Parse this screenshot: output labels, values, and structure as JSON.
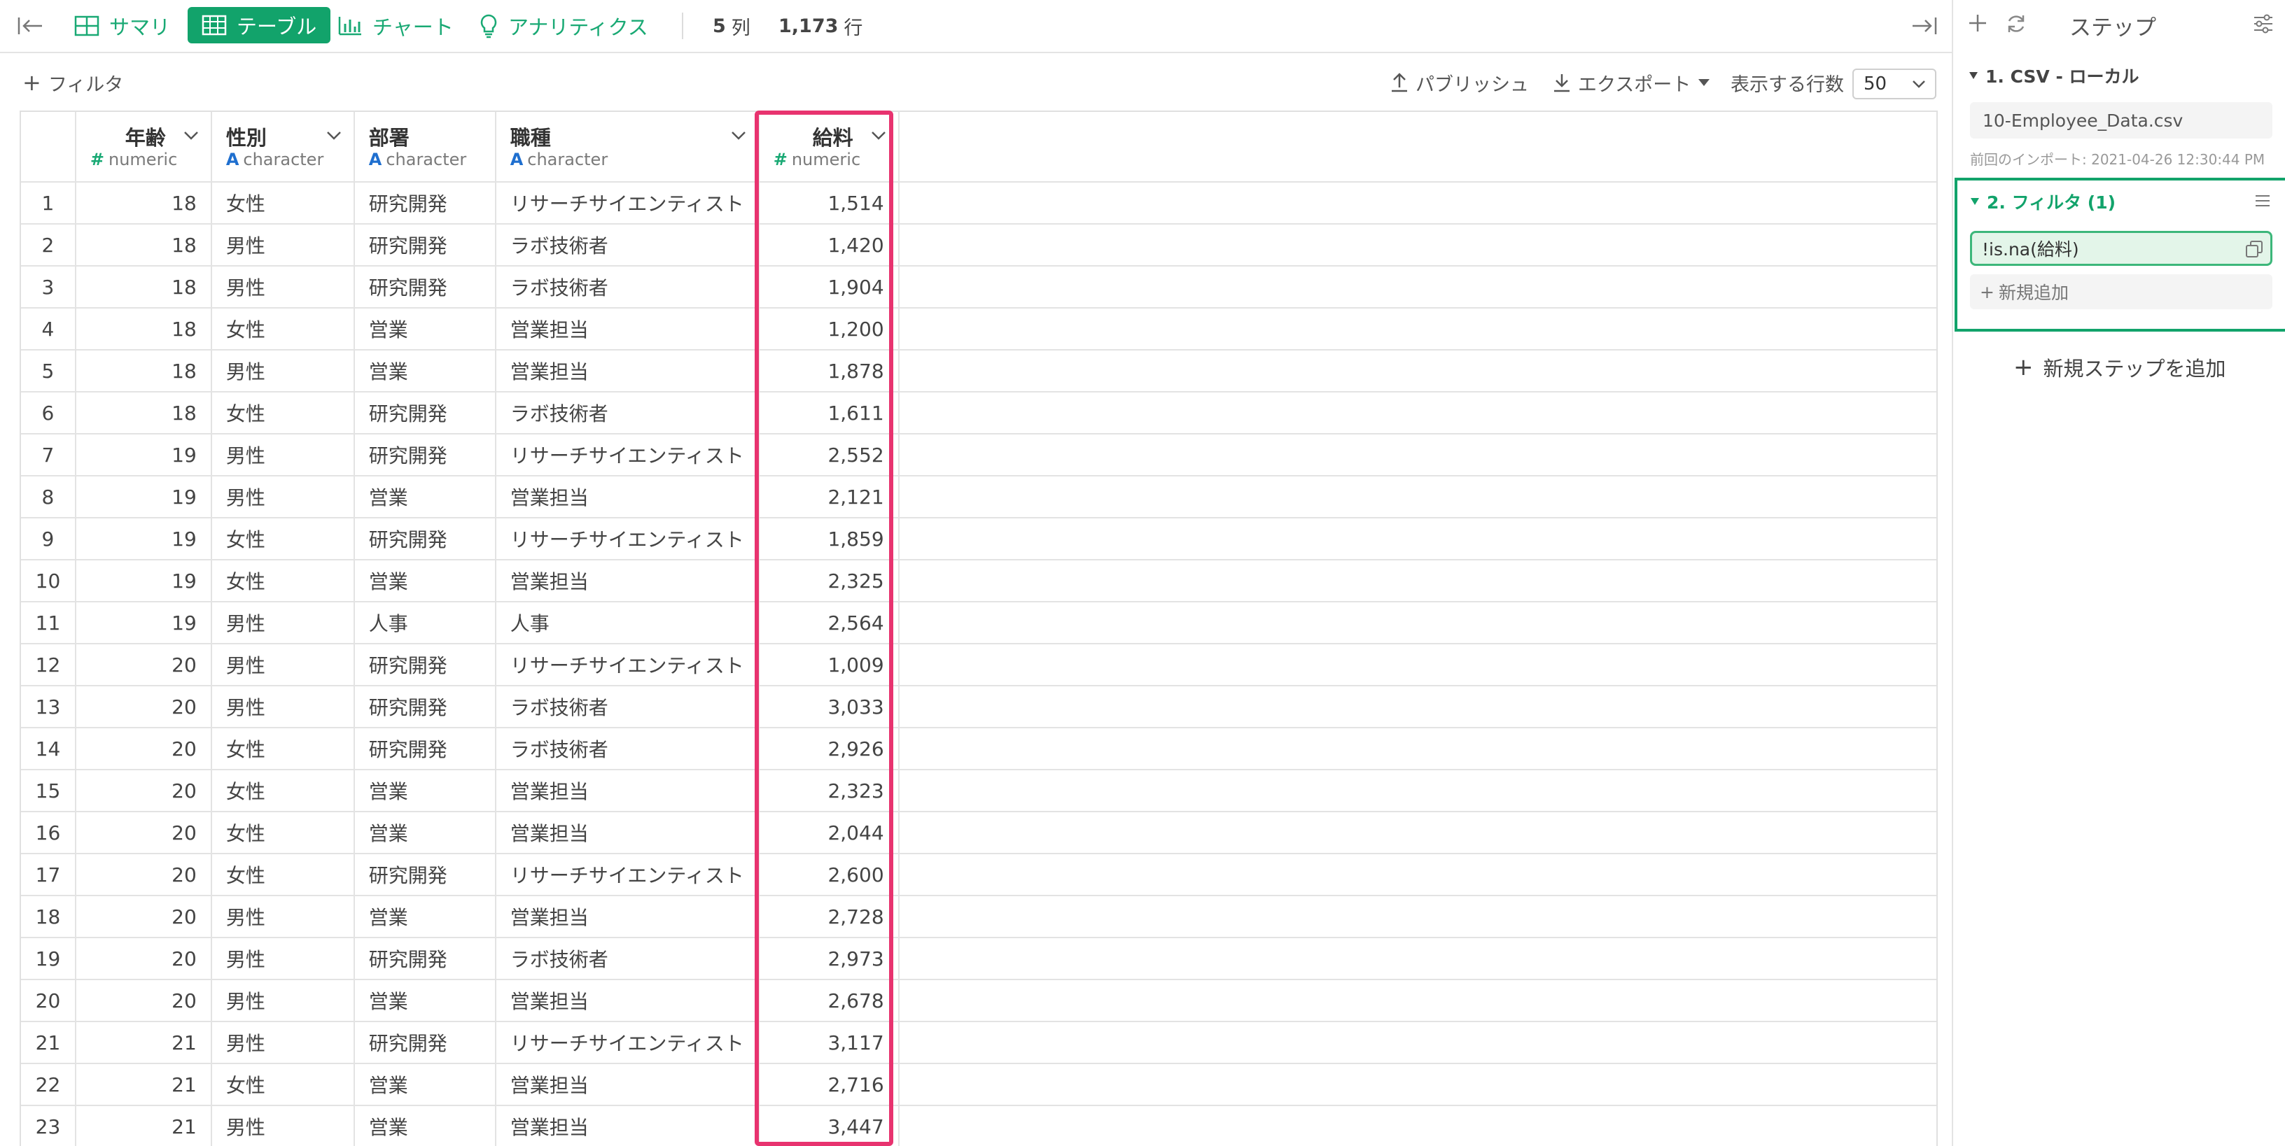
{
  "toolbar": {
    "tabs": [
      {
        "label": "サマリ",
        "icon": "grid-icon"
      },
      {
        "label": "テーブル",
        "icon": "table-icon",
        "active": true
      },
      {
        "label": "チャート",
        "icon": "bar-chart-icon"
      },
      {
        "label": "アナリティクス",
        "icon": "lightbulb-icon"
      }
    ],
    "columns_count": "5",
    "columns_unit": "列",
    "rows_count": "1,173",
    "rows_unit": "行"
  },
  "subtoolbar": {
    "filter_label": "フィルタ",
    "publish_label": "パブリッシュ",
    "export_label": "エクスポート",
    "rows_label": "表示する行数",
    "rows_value": "50"
  },
  "table": {
    "columns": [
      {
        "name": "年齢",
        "type": "numeric",
        "type_icon": "#"
      },
      {
        "name": "性別",
        "type": "character",
        "type_icon": "A"
      },
      {
        "name": "部署",
        "type": "character",
        "type_icon": "A"
      },
      {
        "name": "職種",
        "type": "character",
        "type_icon": "A"
      },
      {
        "name": "給料",
        "type": "numeric",
        "type_icon": "#"
      }
    ],
    "rows": [
      [
        "1",
        "18",
        "女性",
        "研究開発",
        "リサーチサイエンティスト",
        "1,514"
      ],
      [
        "2",
        "18",
        "男性",
        "研究開発",
        "ラボ技術者",
        "1,420"
      ],
      [
        "3",
        "18",
        "男性",
        "研究開発",
        "ラボ技術者",
        "1,904"
      ],
      [
        "4",
        "18",
        "女性",
        "営業",
        "営業担当",
        "1,200"
      ],
      [
        "5",
        "18",
        "男性",
        "営業",
        "営業担当",
        "1,878"
      ],
      [
        "6",
        "18",
        "女性",
        "研究開発",
        "ラボ技術者",
        "1,611"
      ],
      [
        "7",
        "19",
        "男性",
        "研究開発",
        "リサーチサイエンティスト",
        "2,552"
      ],
      [
        "8",
        "19",
        "男性",
        "営業",
        "営業担当",
        "2,121"
      ],
      [
        "9",
        "19",
        "女性",
        "研究開発",
        "リサーチサイエンティスト",
        "1,859"
      ],
      [
        "10",
        "19",
        "女性",
        "営業",
        "営業担当",
        "2,325"
      ],
      [
        "11",
        "19",
        "男性",
        "人事",
        "人事",
        "2,564"
      ],
      [
        "12",
        "20",
        "男性",
        "研究開発",
        "リサーチサイエンティスト",
        "1,009"
      ],
      [
        "13",
        "20",
        "男性",
        "研究開発",
        "ラボ技術者",
        "3,033"
      ],
      [
        "14",
        "20",
        "女性",
        "研究開発",
        "ラボ技術者",
        "2,926"
      ],
      [
        "15",
        "20",
        "女性",
        "営業",
        "営業担当",
        "2,323"
      ],
      [
        "16",
        "20",
        "女性",
        "営業",
        "営業担当",
        "2,044"
      ],
      [
        "17",
        "20",
        "女性",
        "研究開発",
        "リサーチサイエンティスト",
        "2,600"
      ],
      [
        "18",
        "20",
        "男性",
        "営業",
        "営業担当",
        "2,728"
      ],
      [
        "19",
        "20",
        "男性",
        "研究開発",
        "ラボ技術者",
        "2,973"
      ],
      [
        "20",
        "20",
        "男性",
        "営業",
        "営業担当",
        "2,678"
      ],
      [
        "21",
        "21",
        "男性",
        "研究開発",
        "リサーチサイエンティスト",
        "3,117"
      ],
      [
        "22",
        "21",
        "女性",
        "営業",
        "営業担当",
        "2,716"
      ],
      [
        "23",
        "21",
        "男性",
        "営業",
        "営業担当",
        "3,447"
      ]
    ]
  },
  "panel": {
    "title": "ステップ",
    "steps": [
      {
        "label": "1. CSV - ローカル",
        "file": "10-Employee_Data.csv",
        "note": "前回のインポート: 2021-04-26 12:30:44 PM"
      },
      {
        "label": "2. フィルタ (1)",
        "condition": "!is.na(給料)",
        "add_label": "新規追加"
      }
    ],
    "add_step_label": "新規ステップを追加"
  },
  "colors": {
    "accent": "#12a36b",
    "highlight": "#e8336f",
    "character_type": "#1f6fcf"
  }
}
